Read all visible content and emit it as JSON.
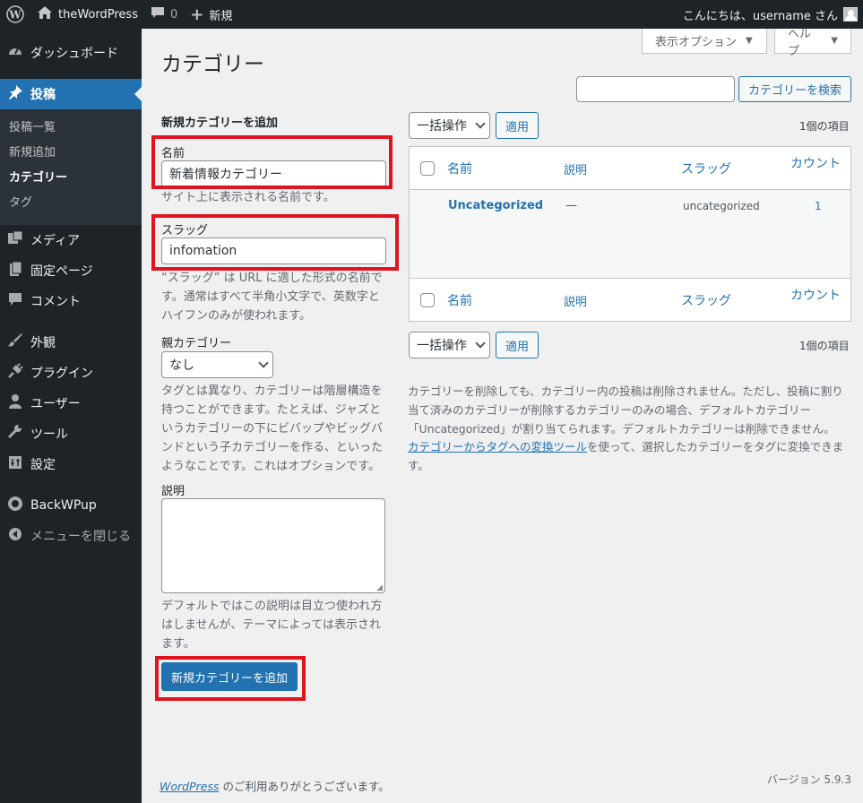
{
  "admin_bar": {
    "site_name": "theWordPress",
    "comments_count": "0",
    "new_label": "新規",
    "greeting": "こんにちは、username さん"
  },
  "sidebar": {
    "dashboard": "ダッシュボード",
    "posts": "投稿",
    "posts_sub": [
      "投稿一覧",
      "新規追加",
      "カテゴリー",
      "タグ"
    ],
    "media": "メディア",
    "pages": "固定ページ",
    "comments": "コメント",
    "appearance": "外観",
    "plugins": "プラグイン",
    "users": "ユーザー",
    "tools": "ツール",
    "settings": "設定",
    "backwpup": "BackWPup",
    "collapse": "メニューを閉じる"
  },
  "header": {
    "screen_options": "表示オプション",
    "help": "ヘルプ",
    "title": "カテゴリー"
  },
  "search": {
    "value": "",
    "button": "カテゴリーを検索"
  },
  "form": {
    "heading": "新規カテゴリーを追加",
    "name_label": "名前",
    "name_value": "新着情報カテゴリー",
    "name_help": "サイト上に表示される名前です。",
    "slug_label": "スラッグ",
    "slug_value": "infomation",
    "slug_help": "“スラッグ” は URL に適した形式の名前です。通常はすべて半角小文字で、英数字とハイフンのみが使われます。",
    "parent_label": "親カテゴリー",
    "parent_value": "なし",
    "parent_help": "タグとは異なり、カテゴリーは階層構造を持つことができます。たとえば、ジャズというカテゴリーの下にビバップやビッグバンドという子カテゴリーを作る、といったようなことです。これはオプションです。",
    "desc_label": "説明",
    "desc_value": "",
    "desc_help": "デフォルトではこの説明は目立つ使われ方はしませんが、テーマによっては表示されます。",
    "submit": "新規カテゴリーを追加"
  },
  "list": {
    "bulk_label": "一括操作",
    "apply": "適用",
    "items_count": "1個の項目",
    "columns": [
      "名前",
      "説明",
      "スラッグ",
      "カウント"
    ],
    "rows": [
      {
        "name": "Uncategorized",
        "description": "—",
        "slug": "uncategorized",
        "count": "1"
      }
    ]
  },
  "notes": {
    "delete_note": "カテゴリーを削除しても、カテゴリー内の投稿は削除されません。ただし、投稿に割り当て済みのカテゴリーが削除するカテゴリーのみの場合、デフォルトカテゴリー「Uncategorized」が割り当てられます。デフォルトカテゴリーは削除できません。",
    "converter_link": "カテゴリーからタグへの変換ツール",
    "converter_rest": "を使って、選択したカテゴリーをタグに変換できます。"
  },
  "footer": {
    "wp_link": "WordPress",
    "thanks": " のご利用ありがとうございます。",
    "version": "バージョン 5.9.3"
  },
  "colors": {
    "admin_dark": "#1d2327",
    "accent": "#2271b1",
    "highlight_border": "#e0141e"
  }
}
